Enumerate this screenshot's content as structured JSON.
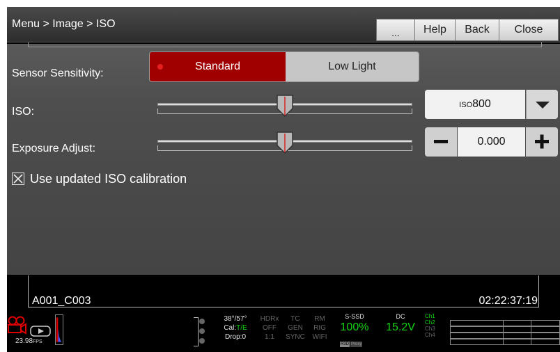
{
  "breadcrumb": "Menu > Image > ISO",
  "top_buttons": {
    "more": "...",
    "help": "Help",
    "back": "Back",
    "close": "Close"
  },
  "sensor": {
    "label": "Sensor Sensitivity:",
    "options": [
      "Standard",
      "Low Light"
    ],
    "selected": "Standard",
    "accent": "#a00000"
  },
  "iso": {
    "label": "ISO:",
    "prefix": "ISO",
    "value": "800",
    "slider_position": 0.5
  },
  "exposure": {
    "label": "Exposure Adjust:",
    "value": "0.000",
    "minus_icon": "minus-icon",
    "plus_icon": "plus-icon",
    "slider_position": 0.5
  },
  "calibration": {
    "label": "Use updated ISO calibration",
    "checked": true
  },
  "clip": {
    "name": "A001_C003",
    "timecode": "02:22:37:19"
  },
  "status": {
    "fps": "23.98",
    "fps_unit": "FPS",
    "temps": "38°/57°",
    "cal_prefix": "Cal:",
    "cal_value": "T/E",
    "drop": "Drop:0",
    "hdrx": [
      "HDRx",
      "OFF",
      "1:1"
    ],
    "tc": [
      "TC",
      "GEN",
      "SYNC"
    ],
    "rm": [
      "RM",
      "RIG",
      "WIFI"
    ],
    "media_label": "S-SSD",
    "media_value": "100%",
    "media_tags": [
      "R3D",
      "Proxy"
    ],
    "power_label": "DC",
    "power_value": "15.2V",
    "channels": [
      "Ch1",
      "Ch2",
      "Ch3",
      "Ch4"
    ]
  }
}
